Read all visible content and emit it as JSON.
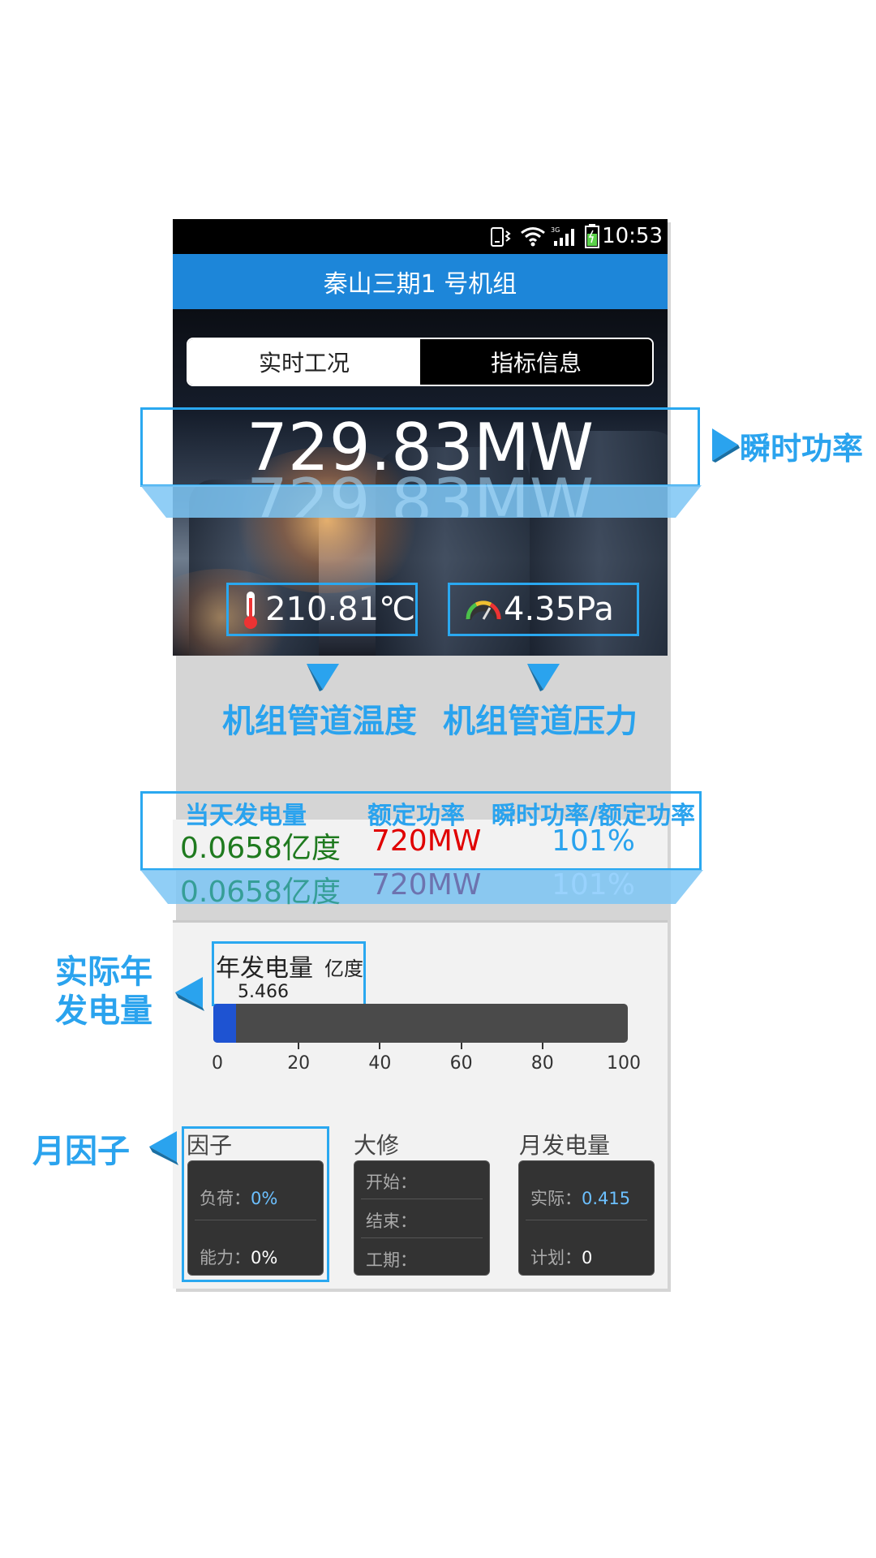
{
  "status_bar": {
    "time": "10:53"
  },
  "title": "秦山三期1 号机组",
  "tabs": [
    {
      "label": "实时工况",
      "active": true
    },
    {
      "label": "指标信息",
      "active": false
    }
  ],
  "instant_power": "729.83MW",
  "temperature": "210.81℃",
  "pressure": "4.35Pa",
  "annotations": {
    "instant_power": "瞬时功率",
    "temperature": "机组管道温度",
    "pressure": "机组管道压力",
    "annual_generation": "实际年发电量",
    "month_factor": "月因子"
  },
  "stats": {
    "headers": [
      "当天发电量",
      "额定功率",
      "瞬时功率/额定功率"
    ],
    "values": [
      "0.0658亿度",
      "720MW",
      "101%"
    ],
    "colors": [
      "#1f7a1f",
      "#e00000",
      "#2aa3ee"
    ]
  },
  "annual": {
    "title": "年发电量",
    "unit": "亿度",
    "value": "5.466",
    "progress": 5.466,
    "ticks": [
      "0",
      "20",
      "40",
      "60",
      "80",
      "100"
    ]
  },
  "cards": {
    "factor": {
      "title": "因子",
      "rows": [
        {
          "label": "负荷：",
          "value": "0%"
        },
        {
          "label": "能力：",
          "value": "0%"
        }
      ]
    },
    "overhaul": {
      "title": "大修",
      "rows": [
        {
          "label": "开始：",
          "value": ""
        },
        {
          "label": "结束：",
          "value": ""
        },
        {
          "label": "工期：",
          "value": ""
        }
      ]
    },
    "monthly": {
      "title": "月发电量",
      "rows": [
        {
          "label": "实际：",
          "value": "0.415"
        },
        {
          "label": "计划：",
          "value": "0"
        }
      ]
    }
  },
  "colors": {
    "accent": "#2aa3ee",
    "title_bar": "#1d86d9",
    "progress": "#1e53d2"
  }
}
